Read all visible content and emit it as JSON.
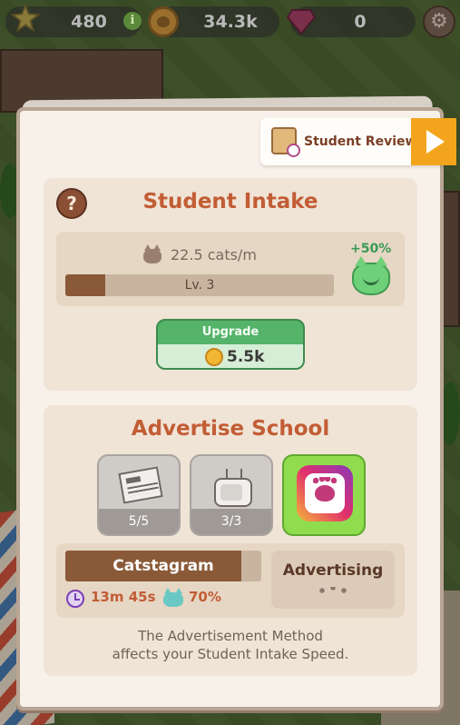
{
  "status_bar": {
    "stars": "480",
    "coins": "34.3k",
    "gems": "0"
  },
  "student_review": {
    "label": "Student Review"
  },
  "intake": {
    "title": "Student Intake",
    "rate": "22.5 cats/m",
    "level": "Lv. 3",
    "level_progress": 0.15,
    "bonus": "+50%",
    "upgrade_label": "Upgrade",
    "upgrade_cost": "5.5k"
  },
  "advertise": {
    "title": "Advertise School",
    "methods": [
      {
        "icon": "newspaper-icon",
        "count": "5/5"
      },
      {
        "icon": "tv-icon",
        "count": "3/3"
      },
      {
        "icon": "catstagram-icon",
        "selected": true
      }
    ],
    "current_method": "Catstagram",
    "method_progress": 0.9,
    "time_left": "13m 45s",
    "percent": "70%",
    "status_label": "Advertising",
    "description_line1": "The Advertisement Method",
    "description_line2": "affects your Student Intake Speed."
  },
  "colors": {
    "accent": "#c25d35",
    "upgrade_green": "#56b36a",
    "play_orange": "#f2a51c"
  }
}
